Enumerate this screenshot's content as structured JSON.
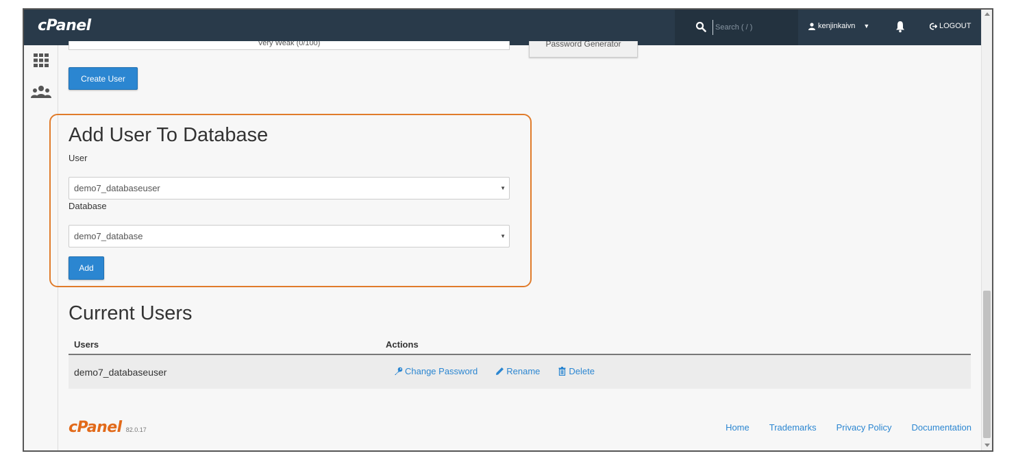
{
  "topbar": {
    "brand": "cPanel",
    "search_placeholder": "Search ( / )",
    "username": "kenjinkaivn",
    "logout_label": "LOGOUT"
  },
  "previous_form": {
    "strength_text": "Very Weak (0/100)",
    "generator_label": "Password Generator",
    "create_user_label": "Create User"
  },
  "add_user_to_db": {
    "title": "Add User To Database",
    "user_label": "User",
    "user_value": "demo7_databaseuser",
    "database_label": "Database",
    "database_value": "demo7_database",
    "add_label": "Add"
  },
  "current_users": {
    "title": "Current Users",
    "col_users": "Users",
    "col_actions": "Actions",
    "rows": [
      {
        "user": "demo7_databaseuser",
        "change_password": "Change Password",
        "rename": "Rename",
        "delete": "Delete"
      }
    ]
  },
  "footer": {
    "brand": "cPanel",
    "version": "82.0.17",
    "links": [
      "Home",
      "Trademarks",
      "Privacy Policy",
      "Documentation"
    ]
  },
  "colors": {
    "topbar": "#293a4a",
    "accent": "#2b86d1",
    "highlight": "#e07b2a",
    "footer_brand": "#e26a1a"
  }
}
